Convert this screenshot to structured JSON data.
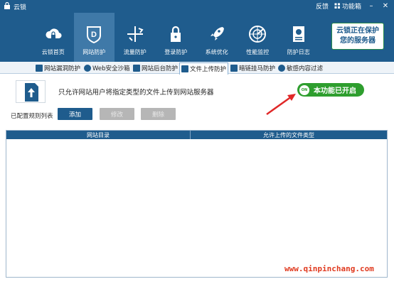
{
  "app": {
    "title": "云锁"
  },
  "titlebar": {
    "feedback": "反馈",
    "menu": "功能箱"
  },
  "nav": [
    {
      "label": "云锁首页"
    },
    {
      "label": "网站防护"
    },
    {
      "label": "流量防护"
    },
    {
      "label": "登录防护"
    },
    {
      "label": "系统优化"
    },
    {
      "label": "性能监控"
    },
    {
      "label": "防护日志"
    }
  ],
  "promo": {
    "line1": "云锁正在保护",
    "line2": "您的服务器"
  },
  "subtabs": [
    {
      "label": "网站漏洞防护"
    },
    {
      "label": "Web安全沙箱"
    },
    {
      "label": "网站后台防护"
    },
    {
      "label": "文件上传防护"
    },
    {
      "label": "暗链挂马防护"
    },
    {
      "label": "敏感内容过滤"
    }
  ],
  "info": {
    "description": "只允许网站用户将指定类型的文件上传到网站服务器",
    "toggle_knob": "ON",
    "status": "本功能已开启"
  },
  "rules": {
    "label": "已配置规则列表",
    "add": "添加",
    "edit": "修改",
    "delete": "删除"
  },
  "table": {
    "columns": [
      "网站目录",
      "允许上传的文件类型"
    ],
    "rows": []
  },
  "watermark": "www.qinpinchang.com",
  "colors": {
    "header": "#1f5c8d",
    "nav_active": "#3f79a8",
    "toggle": "#2e9e2e",
    "watermark": "#e03a1f"
  }
}
